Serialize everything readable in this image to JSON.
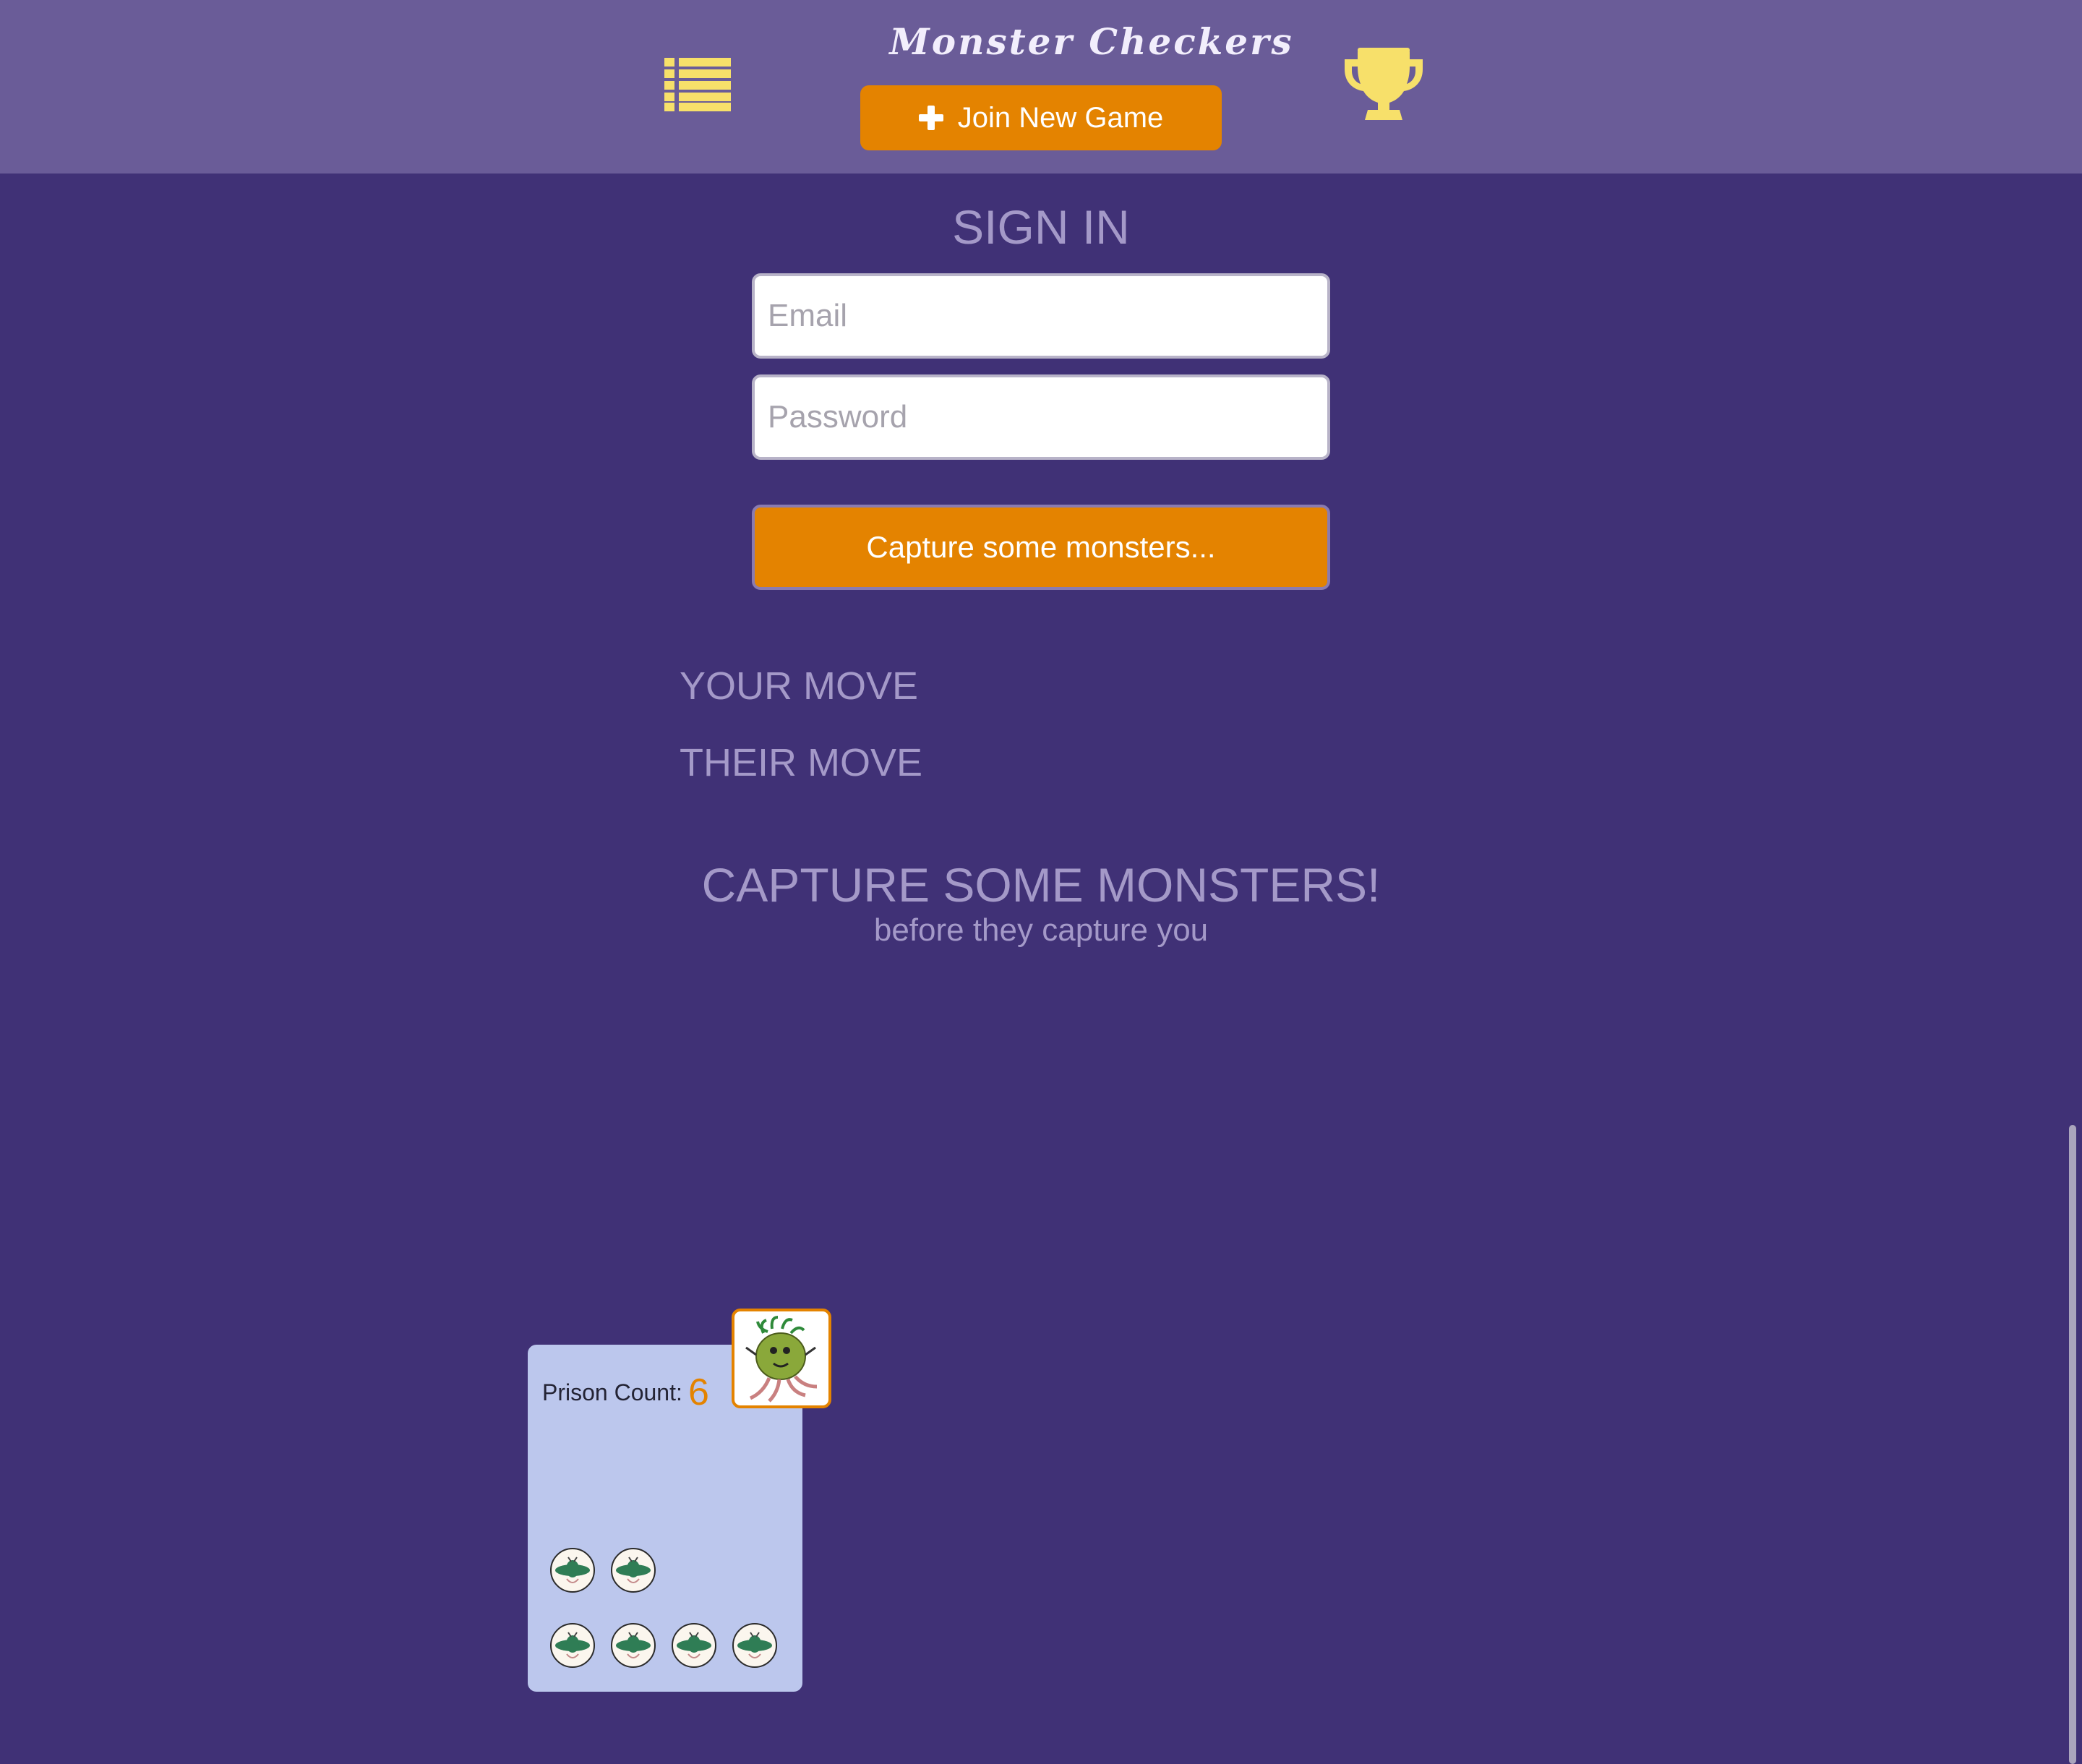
{
  "header": {
    "title": "Monster Checkers",
    "join_button_label": "Join New Game",
    "menu_icon": "list-icon",
    "trophy_icon": "trophy-icon"
  },
  "signin": {
    "heading": "SIGN IN",
    "email_placeholder": "Email",
    "email_value": "",
    "password_placeholder": "Password",
    "password_value": "",
    "submit_label": "Capture some monsters..."
  },
  "moves": {
    "your_move": "YOUR MOVE",
    "their_move": "THEIR MOVE"
  },
  "tagline": {
    "title": "CAPTURE SOME MONSTERS!",
    "subtitle": "before they capture you"
  },
  "prison": {
    "label": "Prison Count:",
    "count": "6",
    "captured_piece_icon": "green-monster-piece-icon",
    "avatar_icon": "medusa-monster-avatar-icon"
  },
  "colors": {
    "background": "#403176",
    "header": "#6a5c98",
    "accent": "#e48300",
    "icon_yellow": "#f7e06a",
    "muted_text": "#a499c8",
    "prison_panel": "#bcc7ed"
  }
}
